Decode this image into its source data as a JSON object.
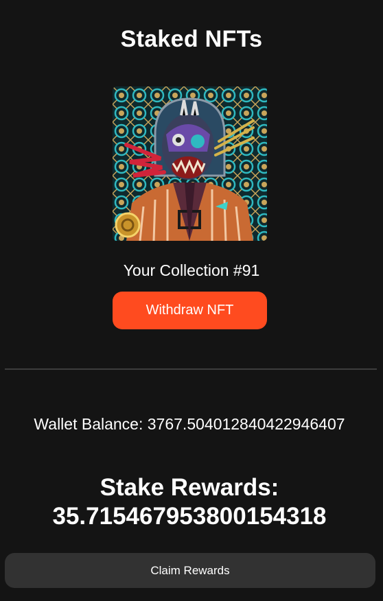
{
  "page": {
    "title": "Staked NFTs"
  },
  "nft": {
    "collection_label": "Your Collection #91",
    "image_icon": "nft-artwork-image",
    "withdraw_label": "Withdraw NFT"
  },
  "wallet": {
    "balance_text": "Wallet Balance: 3767.504012840422946407"
  },
  "rewards": {
    "label": "Stake Rewards:",
    "value": "35.715467953800154318",
    "claim_label": "Claim Rewards"
  },
  "colors": {
    "background": "#141414",
    "accent": "#ff4b1f",
    "secondary_button": "#323232",
    "divider": "#3d3d3d"
  }
}
